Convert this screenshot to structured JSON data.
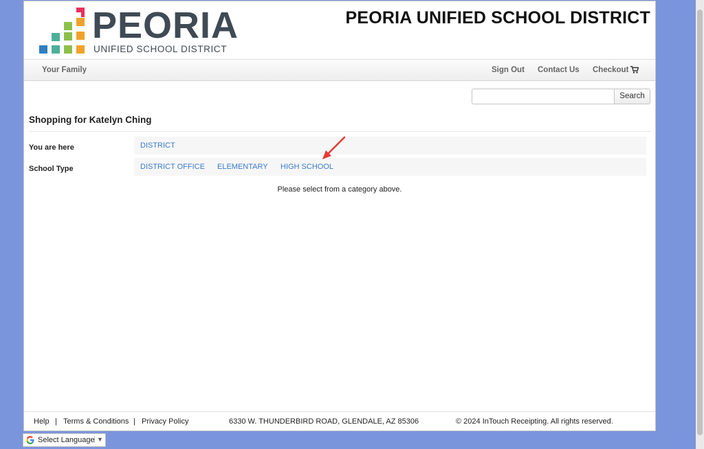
{
  "header": {
    "logo_word": "PEORIA",
    "logo_sub": "UNIFIED SCHOOL DISTRICT",
    "site_title": "PEORIA UNIFIED SCHOOL DISTRICT"
  },
  "nav": {
    "your_family": "Your Family",
    "sign_out": "Sign Out",
    "contact_us": "Contact Us",
    "checkout": "Checkout",
    "cart_icon": "cart-icon"
  },
  "search": {
    "value": "",
    "placeholder": "",
    "button_label": "Search"
  },
  "shopping": {
    "title": "Shopping for Katelyn Ching"
  },
  "breadcrumb": {
    "label": "You are here",
    "items": [
      "DISTRICT"
    ]
  },
  "school_type": {
    "label": "School Type",
    "options": [
      "DISTRICT OFFICE",
      "ELEMENTARY",
      "HIGH SCHOOL"
    ]
  },
  "message": "Please select from a category above.",
  "footer": {
    "help": "Help",
    "terms": "Terms & Conditions",
    "privacy": "Privacy Policy",
    "sep": "|",
    "address": "6330 W. THUNDERBIRD ROAD, GLENDALE, AZ 85306",
    "copyright": "© 2024 InTouch Receipting. All rights reserved."
  },
  "language": {
    "label": "Select Language",
    "caret": "▼"
  },
  "colors": {
    "background": "#7b95dc",
    "link": "#3a7bc8",
    "annotation_arrow": "#e53935"
  }
}
